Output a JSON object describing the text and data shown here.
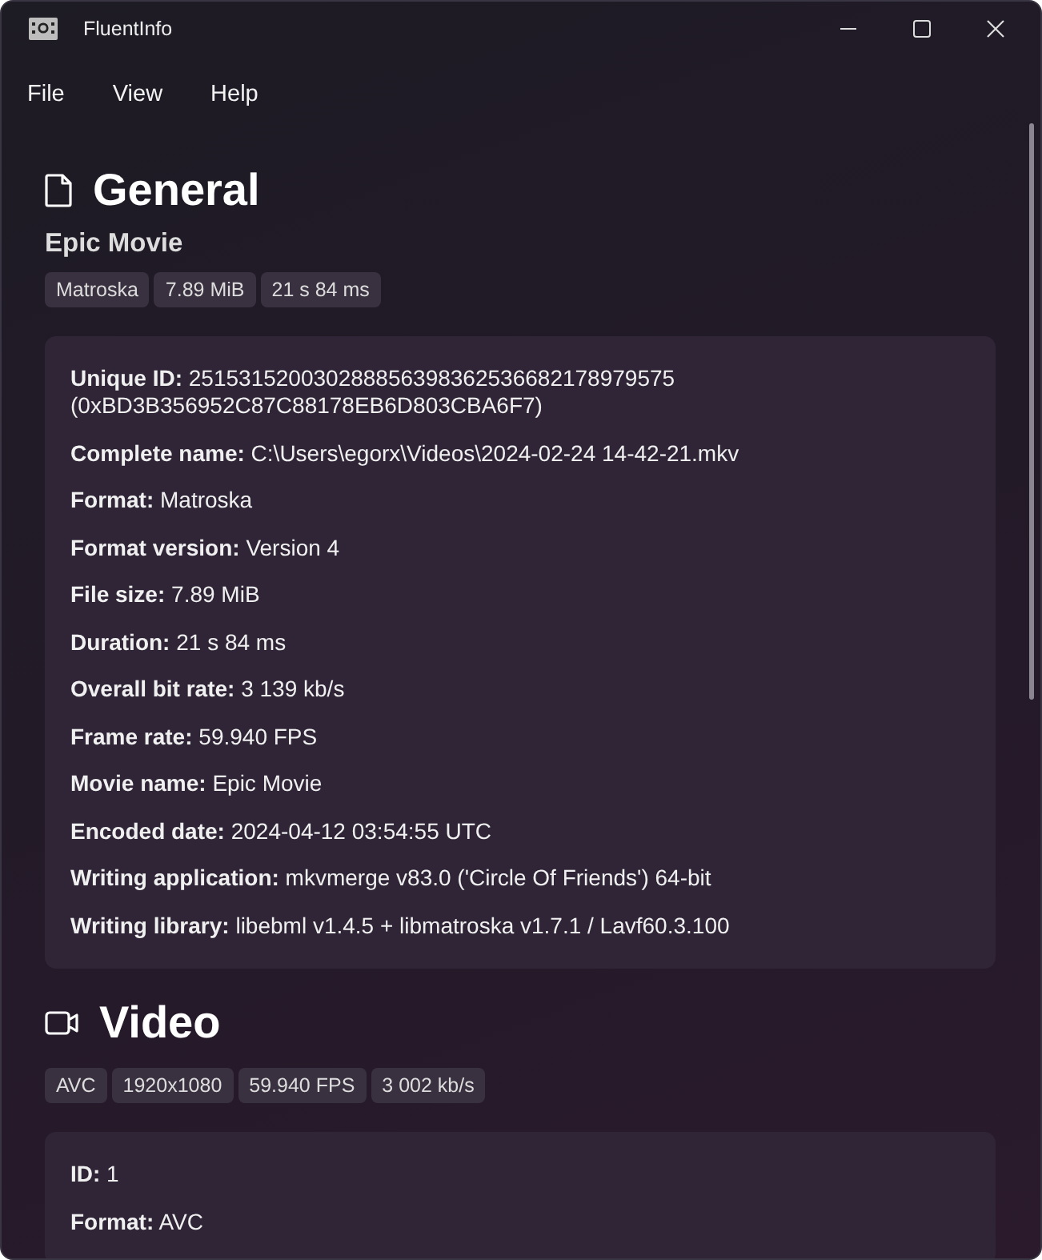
{
  "window": {
    "title": "FluentInfo"
  },
  "menu": [
    "File",
    "View",
    "Help"
  ],
  "sections": [
    {
      "kind": "general",
      "title": "General",
      "subtitle": "Epic Movie",
      "tags": [
        "Matroska",
        "7.89 MiB",
        "21 s 84 ms"
      ],
      "fields": [
        "**Unique ID:** 251531520030288856398362536682178979575 (0xBD3B356952C87C88178EB6D803CBA6F7)",
        "**Complete name:** C:\\Users\\egorx\\Videos\\2024-02-24 14-42-21.mkv",
        "**Format:** Matroska",
        "**Format version:** Version 4",
        "**File size:** 7.89 MiB",
        "**Duration:** 21 s 84 ms",
        "**Overall bit rate:** 3 139 kb/s",
        "**Frame rate:** 59.940 FPS",
        "**Movie name:** Epic Movie",
        "**Encoded date:** 2024-04-12 03:54:55 UTC",
        "**Writing application:** mkvmerge v83.0 ('Circle Of Friends') 64-bit",
        "**Writing library:** libebml v1.4.5 + libmatroska v1.7.1 / Lavf60.3.100"
      ]
    },
    {
      "kind": "video",
      "title": "Video",
      "tags": [
        "AVC",
        "1920x1080",
        "59.940 FPS",
        "3 002 kb/s"
      ],
      "fields": [
        "**ID:** 1",
        "**Format:** AVC"
      ]
    }
  ]
}
